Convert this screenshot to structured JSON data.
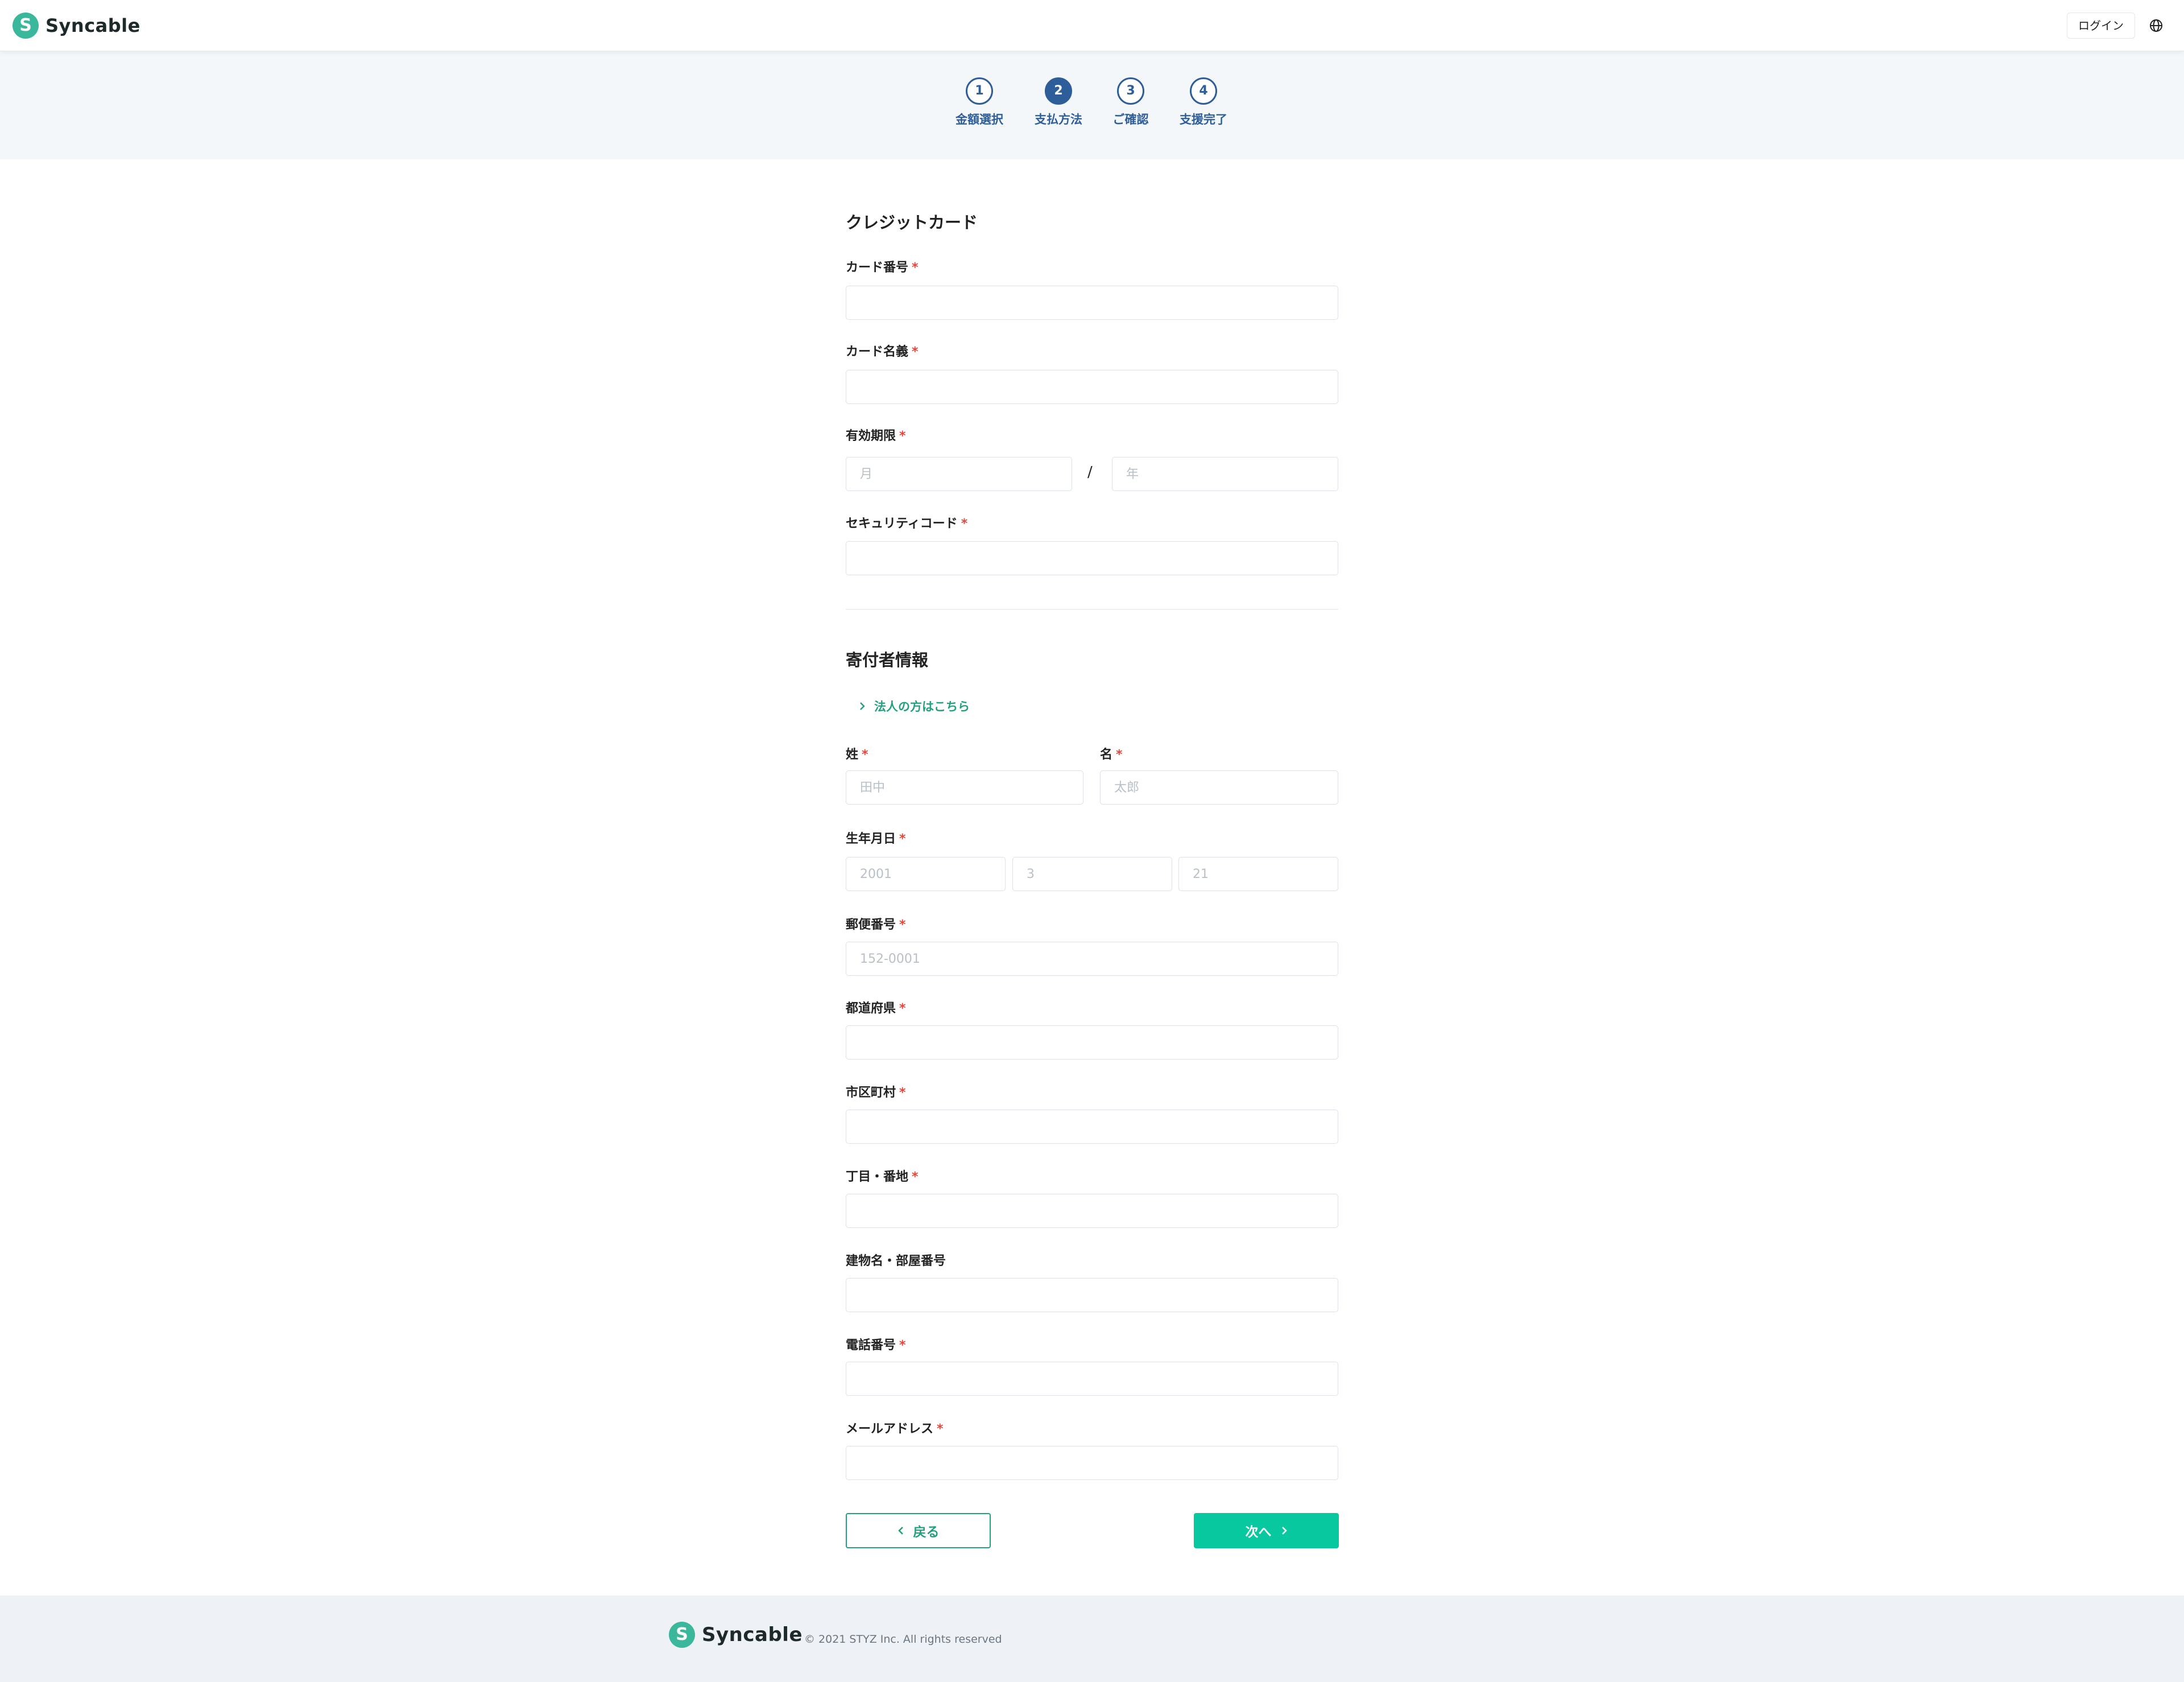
{
  "header": {
    "brand": "Syncable",
    "logo_glyph": "S",
    "login_label": "ログイン",
    "language_icon": "globe-icon"
  },
  "stepper": {
    "current_step": 2,
    "steps": [
      {
        "number": "1",
        "label": "金額選択"
      },
      {
        "number": "2",
        "label": "支払方法"
      },
      {
        "number": "3",
        "label": "ご確認"
      },
      {
        "number": "4",
        "label": "支援完了"
      }
    ]
  },
  "credit_card": {
    "title": "クレジットカード",
    "card_number": {
      "label": "カード番号",
      "required_mark": "*",
      "value": "",
      "placeholder": ""
    },
    "card_name": {
      "label": "カード名義",
      "required_mark": "*",
      "value": "",
      "placeholder": ""
    },
    "expiry": {
      "label": "有効期限",
      "required_mark": "*",
      "month_placeholder": "月",
      "separator": "/",
      "year_placeholder": "年"
    },
    "security_code": {
      "label": "セキュリティコード",
      "required_mark": "*",
      "value": "",
      "placeholder": ""
    }
  },
  "donor": {
    "title": "寄付者情報",
    "corporate_link": "法人の方はこちら",
    "last_name": {
      "label": "姓",
      "required_mark": "*",
      "placeholder": "田中"
    },
    "first_name": {
      "label": "名",
      "required_mark": "*",
      "placeholder": "太郎"
    },
    "birthdate": {
      "label": "生年月日",
      "required_mark": "*",
      "year_placeholder": "2001",
      "month_placeholder": "3",
      "day_placeholder": "21"
    },
    "postal_code": {
      "label": "郵便番号",
      "required_mark": "*",
      "placeholder": "152-0001"
    },
    "prefecture": {
      "label": "都道府県",
      "required_mark": "*",
      "placeholder": ""
    },
    "city": {
      "label": "市区町村",
      "required_mark": "*",
      "placeholder": ""
    },
    "street": {
      "label": "丁目・番地",
      "required_mark": "*",
      "placeholder": ""
    },
    "building": {
      "label": "建物名・部屋番号",
      "placeholder": ""
    },
    "phone": {
      "label": "電話番号",
      "required_mark": "*",
      "placeholder": ""
    },
    "email": {
      "label": "メールアドレス",
      "required_mark": "*",
      "placeholder": ""
    }
  },
  "actions": {
    "back_label": "戻る",
    "next_label": "次へ"
  },
  "footer": {
    "brand": "Syncable",
    "copyright": "© 2021 STYZ Inc. All rights reserved"
  },
  "colors": {
    "brand_green": "#3bb79b",
    "primary_teal": "#08c8a0",
    "link_green": "#22a07f",
    "step_blue": "#2d5e9a",
    "required_red": "#e0473d"
  }
}
